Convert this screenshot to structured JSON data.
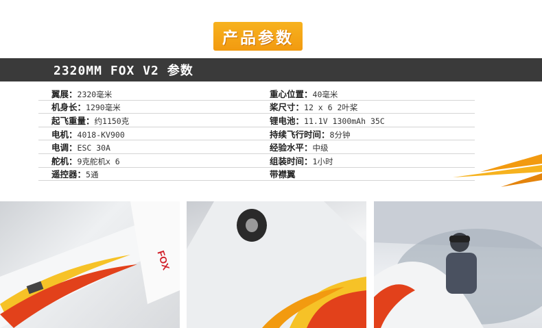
{
  "header": {
    "badge": "产品参数",
    "title": "2320MM FOX  V2  参数"
  },
  "specs": {
    "rows": [
      {
        "left": {
          "key": "翼展：",
          "value": "2320毫米"
        },
        "right": {
          "key": "重心位置：",
          "value": "40毫米"
        }
      },
      {
        "left": {
          "key": "机身长：",
          "value": "1290毫米"
        },
        "right": {
          "key": "桨尺寸：",
          "value": "12 x 6 2叶桨"
        }
      },
      {
        "left": {
          "key": "起飞重量：",
          "value": "约1150克"
        },
        "right": {
          "key": "锂电池：",
          "value": "11.1V 1300mAh 35C"
        }
      },
      {
        "left": {
          "key": "电机：",
          "value": "4018-KV900"
        },
        "right": {
          "key": "持续飞行时间：",
          "value": "8分钟"
        }
      },
      {
        "left": {
          "key": "电调：",
          "value": "ESC 30A"
        },
        "right": {
          "key": "经验水平：",
          "value": "中级"
        }
      },
      {
        "left": {
          "key": "舵机：",
          "value": "9克舵机x 6"
        },
        "right": {
          "key": "组装时间：",
          "value": "1小时"
        }
      },
      {
        "left": {
          "key": "遥控器：",
          "value": "5通"
        },
        "right": {
          "key": "带襟翼",
          "value": ""
        }
      }
    ]
  },
  "photos": {
    "fuselage_marking": "FOX",
    "colors": {
      "accent": "#f29a10",
      "flame_red": "#e2411b",
      "flame_yellow": "#f6c227"
    }
  }
}
